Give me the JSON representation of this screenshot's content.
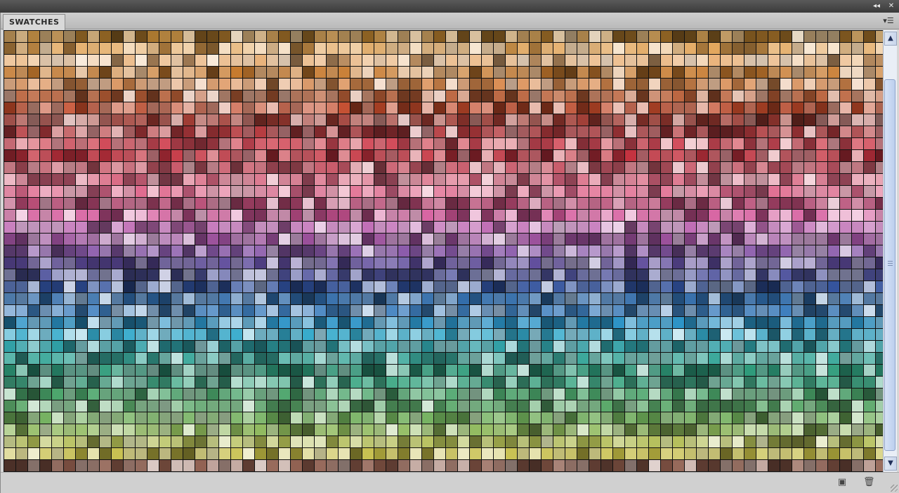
{
  "window": {
    "collapse_icon": "double-left-arrow-icon",
    "close_icon": "close-icon"
  },
  "panel": {
    "tab_label": "SWATCHES",
    "menu_icon": "panel-menu-icon"
  },
  "swatches": {
    "bands": [
      "#a8742a",
      "#e0a050",
      "#e9b27a",
      "#c77a2e",
      "#d98a4e",
      "#b85e36",
      "#c34a2a",
      "#9e3a32",
      "#b53b3f",
      "#d14a58",
      "#c4323f",
      "#c85a6a",
      "#d86680",
      "#e06b8f",
      "#b54872",
      "#d4579a",
      "#c06db5",
      "#9a4f9a",
      "#8a5aaa",
      "#5d4a9a",
      "#51559e",
      "#2f4f9a",
      "#2f6aa8",
      "#3f7fbe",
      "#2b93c6",
      "#35aacb",
      "#2f9ea5",
      "#3aa79a",
      "#2e9a7a",
      "#44aa88",
      "#4aa46a",
      "#5ba86a",
      "#6fae5a",
      "#8db85a",
      "#b2bd55",
      "#c4bc44",
      "#8c5a4a",
      "#6a5150"
    ],
    "tail_colors": [
      "#9fa6a8",
      "#b5bcbd",
      "#a8b0b2",
      "#c5cbcc",
      "#8e9799",
      "#b9c0c1",
      "#d2d6d6",
      "#c7c9c0",
      "#d4d6cc",
      "#b8bab0",
      "#d0d2c8",
      "#a9ab9f",
      "#c2c4b8",
      "#dadcd2",
      "#b4b8ae",
      "#ccd0c6"
    ]
  },
  "scrollbar": {
    "up_icon": "scroll-up-arrow-icon",
    "down_icon": "scroll-down-arrow-icon"
  },
  "footer": {
    "new_swatch_icon": "new-swatch-icon",
    "delete_icon": "trash-icon"
  }
}
